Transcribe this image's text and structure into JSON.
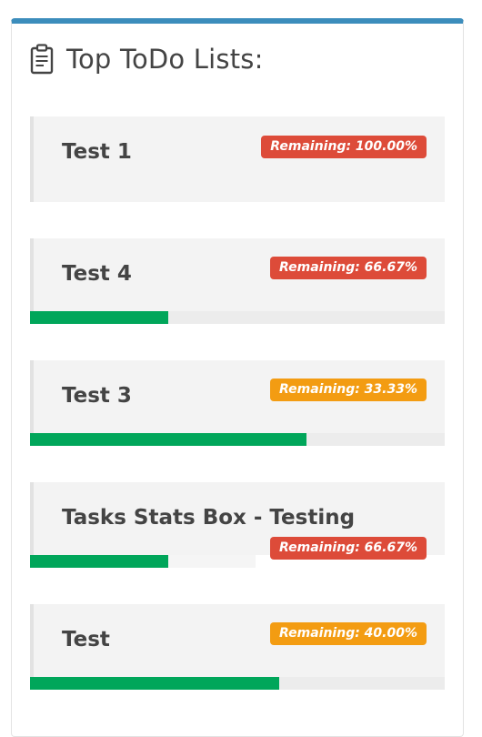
{
  "box": {
    "title": "Top ToDo Lists:",
    "icon": "clipboard-icon",
    "accent_color": "#3c8dbc"
  },
  "todos": [
    {
      "name": "Test 1",
      "remaining_label": "Remaining: 100.00%",
      "badge_color": "#dd4b39",
      "progress": 0.0
    },
    {
      "name": "Test 4",
      "remaining_label": "Remaining: 66.67%",
      "badge_color": "#dd4b39",
      "progress": 0.3333
    },
    {
      "name": "Test 3",
      "remaining_label": "Remaining: 33.33%",
      "badge_color": "#f39c12",
      "progress": 0.6667
    },
    {
      "name": "Tasks Stats Box - Testing",
      "remaining_label": "Remaining: 66.67%",
      "badge_color": "#dd4b39",
      "progress": 0.3333
    },
    {
      "name": "Test",
      "remaining_label": "Remaining: 40.00%",
      "badge_color": "#f39c12",
      "progress": 0.6
    }
  ],
  "progress_color": "#00a65a"
}
